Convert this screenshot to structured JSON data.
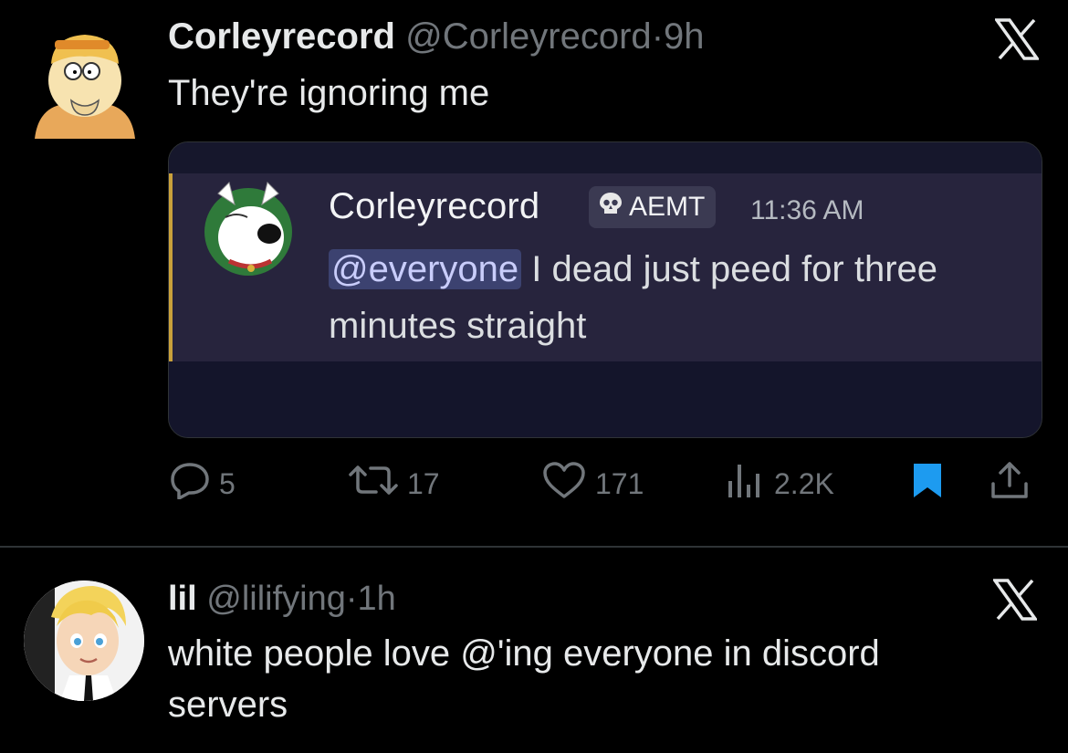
{
  "tweet1": {
    "display_name": "Corleyrecord",
    "handle": "@Corleyrecord",
    "separator": "·",
    "time": "9h",
    "text": "They're ignoring me",
    "embedded_message": {
      "username": "Corleyrecord",
      "tag": "AEMT",
      "timestamp": "11:36 AM",
      "mention": "@everyone",
      "message": " I dead just peed for three minutes straight"
    },
    "actions": {
      "replies": "5",
      "reposts": "17",
      "likes": "171",
      "views": "2.2K"
    }
  },
  "tweet2": {
    "display_name": "lil",
    "handle": "@lilifying",
    "separator": "·",
    "time": "1h",
    "text": "white people love @'ing everyone in discord servers"
  },
  "colors": {
    "background": "#000000",
    "primary_text": "#e7e9ea",
    "secondary_text": "#71767b",
    "bookmark_active": "#1d9bf0",
    "mention_bg": "#3c4270"
  }
}
